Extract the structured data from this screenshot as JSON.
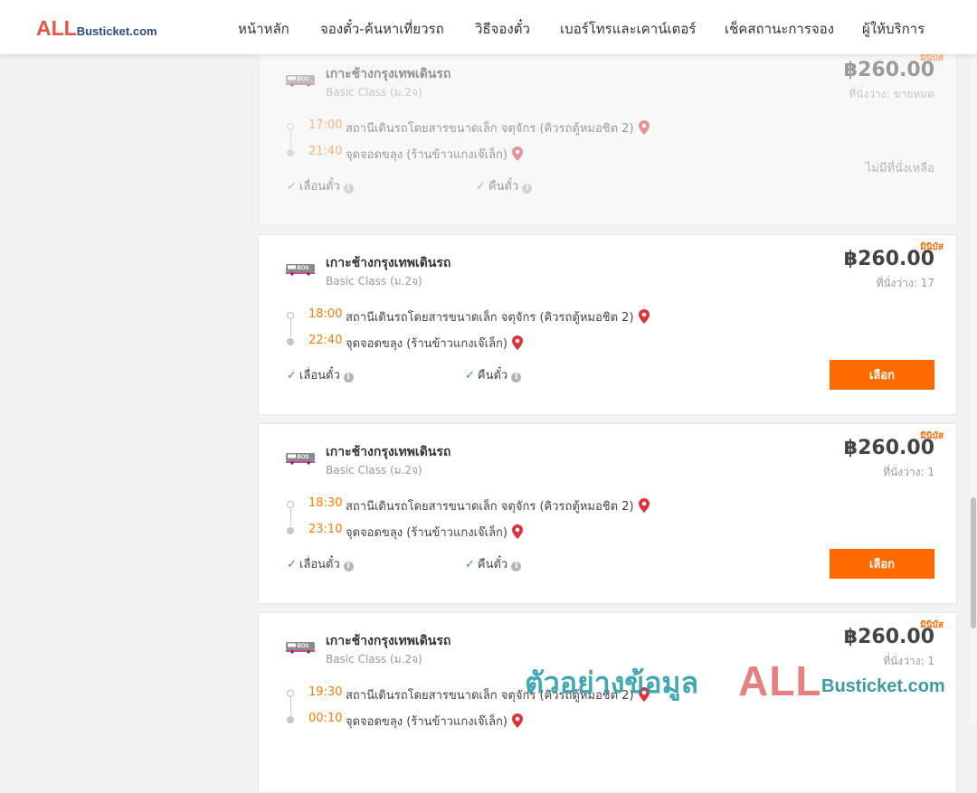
{
  "header": {
    "logo_all": "ALL",
    "logo_rest": "Busticket.com",
    "nav": [
      "หน้าหลัก",
      "จองตั๋ว-ค้นหาเที่ยวรถ",
      "วิธีจองตั๋ว",
      "เบอร์โทรและเคาน์เตอร์",
      "เช็คสถานะการจอง",
      "ผู้ให้บริการ"
    ]
  },
  "colors": {
    "accent": "#ff6a00",
    "time": "#ff7a00",
    "check": "#3aa24a",
    "pin": "#e0323a"
  },
  "trips": [
    {
      "badge": "มินิบัส",
      "route": "เกาะช้างกรุงเทพเดินรถ",
      "class": "Basic Class (ม.2จ)",
      "price": "฿260.00",
      "seats": "ที่นั่งว่าง: ขายหมด",
      "dep_time": "17:00",
      "dep_place": "สถานีเดินรถโดยสารขนาดเล็ก จตุจักร (คิวรถตู้หมอชิต 2)",
      "arr_time": "21:40",
      "arr_place": "จุดจอดขลุง (ร้านข้าวแกงเจ๊เล็ก)",
      "feature1": "เลื่อนตั๋ว",
      "feature2": "คืนตั๋ว",
      "status": "ไม่มีที่นั่งเหลือ"
    },
    {
      "badge": "มินิบัส",
      "route": "เกาะช้างกรุงเทพเดินรถ",
      "class": "Basic Class (ม.2จ)",
      "price": "฿260.00",
      "seats": "ที่นั่งว่าง: 17",
      "dep_time": "18:00",
      "dep_place": "สถานีเดินรถโดยสารขนาดเล็ก จตุจักร (คิวรถตู้หมอชิต 2)",
      "arr_time": "22:40",
      "arr_place": "จุดจอดขลุง (ร้านข้าวแกงเจ๊เล็ก)",
      "feature1": "เลื่อนตั๋ว",
      "feature2": "คืนตั๋ว",
      "button": "เลือก"
    },
    {
      "badge": "มินิบัส",
      "route": "เกาะช้างกรุงเทพเดินรถ",
      "class": "Basic Class (ม.2จ)",
      "price": "฿260.00",
      "seats": "ที่นั่งว่าง: 1",
      "dep_time": "18:30",
      "dep_place": "สถานีเดินรถโดยสารขนาดเล็ก จตุจักร (คิวรถตู้หมอชิต 2)",
      "arr_time": "23:10",
      "arr_place": "จุดจอดขลุง (ร้านข้าวแกงเจ๊เล็ก)",
      "feature1": "เลื่อนตั๋ว",
      "feature2": "คืนตั๋ว",
      "button": "เลือก"
    },
    {
      "badge": "มินิบัส",
      "route": "เกาะช้างกรุงเทพเดินรถ",
      "class": "Basic Class (ม.2จ)",
      "price": "฿260.00",
      "seats": "ที่นั่งว่าง: 1",
      "dep_time": "19:30",
      "dep_place": "สถานีเดินรถโดยสารขนาดเล็ก จตุจักร (คิวรถตู้หมอชิต 2)",
      "arr_time": "00:10",
      "arr_place": "จุดจอดขลุง (ร้านข้าวแกงเจ๊เล็ก)"
    }
  ],
  "watermark": {
    "thai": "ตัวอย่างข้อมูล",
    "all": "ALL",
    "rest": "Busticket.com"
  }
}
